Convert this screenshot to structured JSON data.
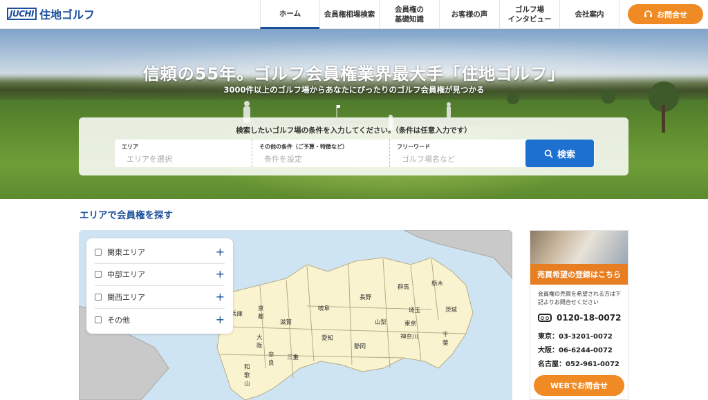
{
  "header": {
    "logo_mark": "JUCHI",
    "logo_text": "住地ゴルフ",
    "nav": [
      {
        "label": "ホーム"
      },
      {
        "label": "会員権相場検索"
      },
      {
        "label": "会員権の\n基礎知識"
      },
      {
        "label": "お客様の声"
      },
      {
        "label": "ゴルフ場\nインタビュー"
      },
      {
        "label": "会社案内"
      }
    ],
    "contact_label": "お問合せ"
  },
  "hero": {
    "title": "信頼の55年。ゴルフ会員権業界最大手「住地ゴルフ」",
    "subtitle": "3000件以上のゴルフ場からあなたにぴったりのゴルフ会員権が見つかる"
  },
  "search": {
    "caption": "検索したいゴルフ場の条件を入力してください。（条件は任意入力です）",
    "fields": [
      {
        "label": "エリア",
        "placeholder": "エリアを選択"
      },
      {
        "label": "その他の条件（ご予算・特徴など）",
        "placeholder": "条件を設定"
      },
      {
        "label": "フリーワード",
        "placeholder": "ゴルフ場名など"
      }
    ],
    "button_label": "検索"
  },
  "area_section": {
    "title": "エリアで会員権を探す",
    "areas": [
      {
        "label": "関東エリア"
      },
      {
        "label": "中部エリア"
      },
      {
        "label": "関西エリア"
      },
      {
        "label": "その他"
      }
    ],
    "prefectures": [
      "兵庫",
      "京\n都",
      "滋賀",
      "大\n阪",
      "奈\n良",
      "和\n歌\n山",
      "三重",
      "岐阜",
      "愛知",
      "静岡",
      "長野",
      "山梨",
      "群馬",
      "栃木",
      "埼玉",
      "茨城",
      "東京",
      "神奈川",
      "千\n葉"
    ]
  },
  "side_card": {
    "heading": "売買希望の登録はこちら",
    "description": "会員権の売買を希望される方は下記よりお問合せください",
    "free_dial": "0120-18-0072",
    "tels": [
      "東京：03-3201-0072",
      "大阪：06-6244-0072",
      "名古屋：052-961-0072"
    ],
    "web_button": "WEBでお問合せ"
  },
  "colors": {
    "brand": "#1b4f9c",
    "accent": "#f08a24",
    "search_button": "#1d6fd0"
  }
}
